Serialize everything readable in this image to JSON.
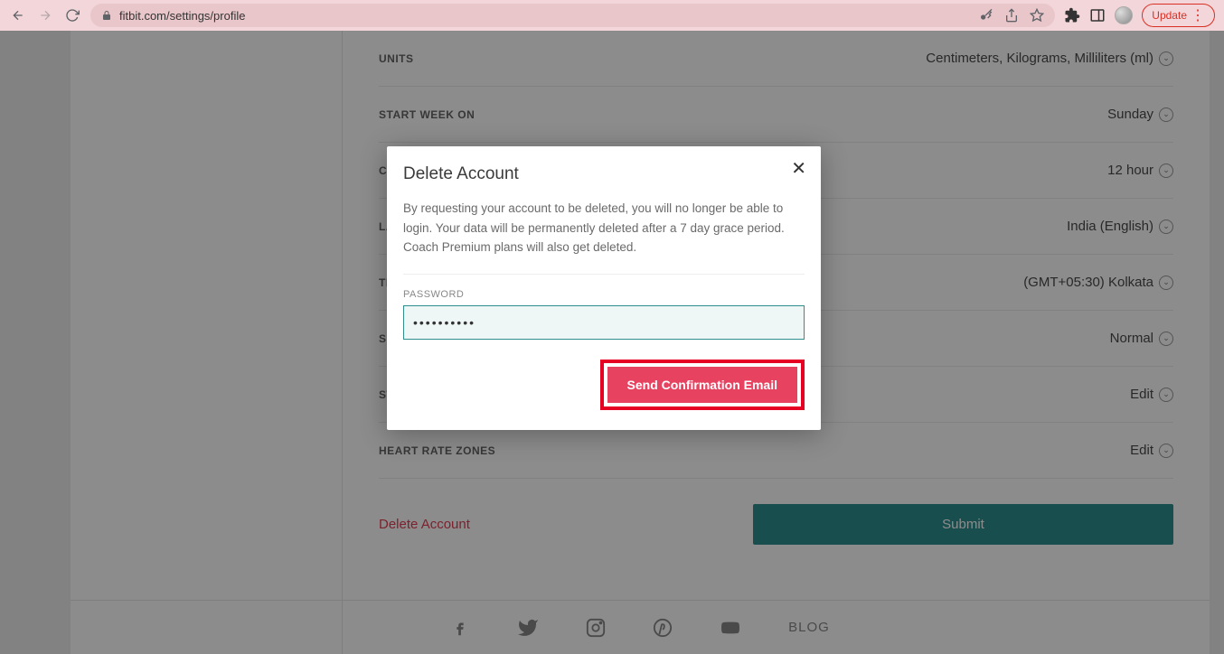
{
  "browser": {
    "url": "fitbit.com/settings/profile",
    "update_label": "Update"
  },
  "settings": {
    "rows": [
      {
        "label": "UNITS",
        "value": "Centimeters, Kilograms, Milliliters (ml)"
      },
      {
        "label": "START WEEK ON",
        "value": "Sunday"
      },
      {
        "label": "CLOCK DISPLAY TIME",
        "value": "12 hour"
      },
      {
        "label": "LANGUAGE",
        "value": "India (English)"
      },
      {
        "label": "TIMEZONE",
        "value": "(GMT+05:30) Kolkata"
      },
      {
        "label": "SLEEP SENSITIVITY",
        "value": "Normal"
      },
      {
        "label": "STRIDE LENGTH",
        "value": "Edit"
      },
      {
        "label": "HEART RATE ZONES",
        "value": "Edit"
      }
    ],
    "delete_link": "Delete Account",
    "submit_label": "Submit",
    "footer_blog": "BLOG"
  },
  "modal": {
    "title": "Delete Account",
    "body": "By requesting your account to be deleted, you will no longer be able to login. Your data will be permanently deleted after a 7 day grace period. Coach Premium plans will also get deleted.",
    "password_label": "PASSWORD",
    "password_value": "••••••••••",
    "confirm_label": "Send Confirmation Email"
  }
}
